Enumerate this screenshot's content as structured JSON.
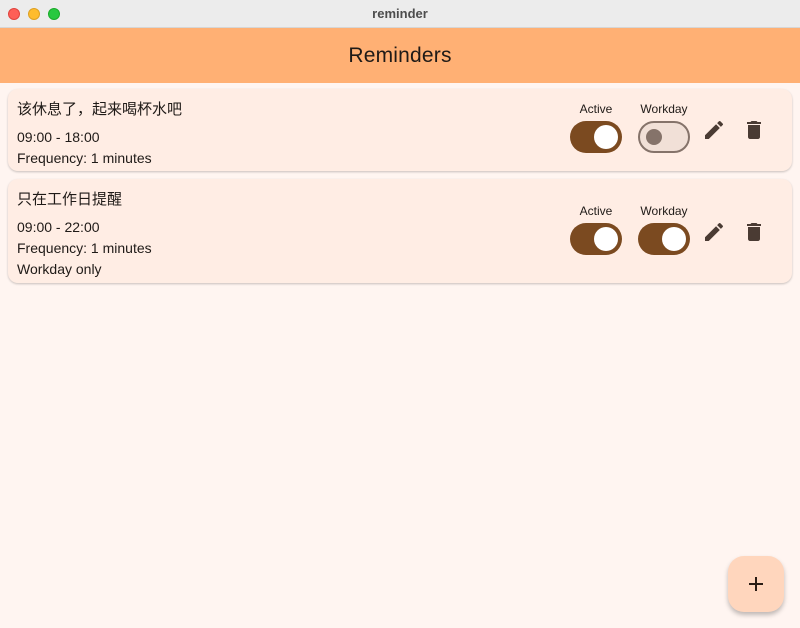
{
  "window": {
    "title": "reminder"
  },
  "appbar": {
    "title": "Reminders"
  },
  "labels": {
    "active": "Active",
    "workday": "Workday"
  },
  "reminders": [
    {
      "title": "该休息了，起来喝杯水吧",
      "time_range": "09:00 - 18:00",
      "frequency": "Frequency: 1 minutes",
      "active": true,
      "workday": false
    },
    {
      "title": "只在工作日提醒",
      "time_range": "09:00 - 22:00",
      "frequency": "Frequency: 1 minutes",
      "workday_note": "Workday only",
      "active": true,
      "workday": true
    }
  ],
  "icons": {
    "edit": "pencil-icon",
    "delete": "trash-icon",
    "add": "plus-icon"
  },
  "colors": {
    "appbar": "#ffb074",
    "background": "#fff5f1",
    "card": "#ffede4",
    "switch_on": "#7b4a20",
    "switch_off_track": "#f1e0d7",
    "icon": "#4a3b33",
    "fab": "#ffd6bd"
  }
}
